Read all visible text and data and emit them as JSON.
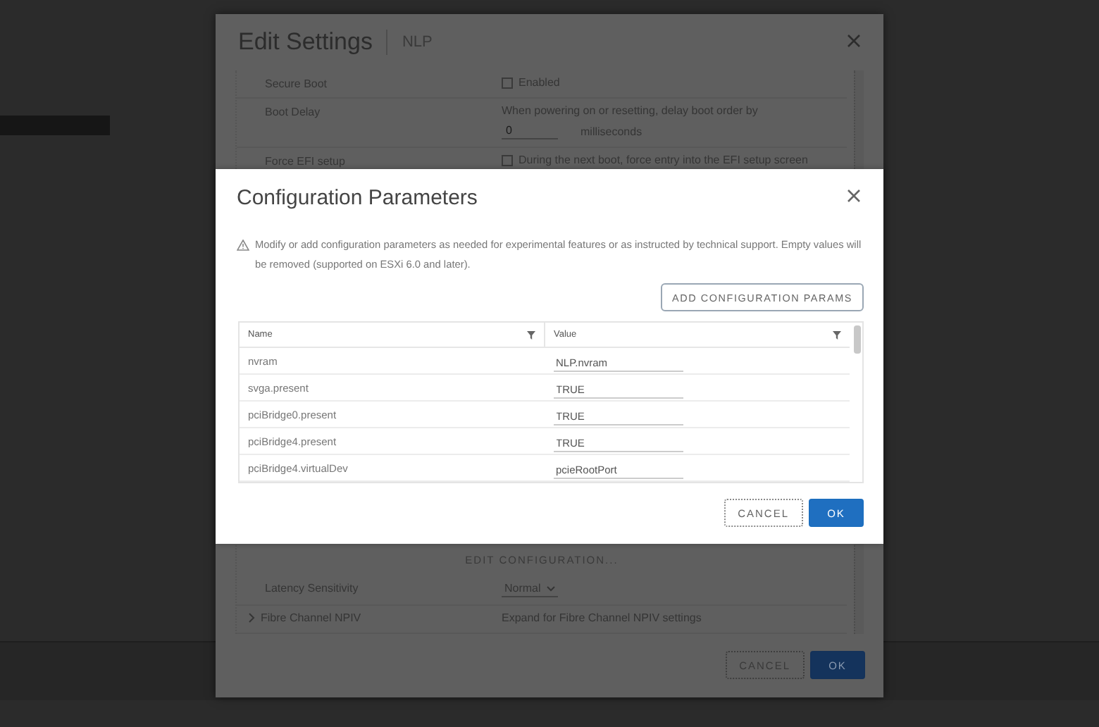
{
  "edit_settings": {
    "title": "Edit Settings",
    "subtitle": "NLP",
    "upper_rows": [
      {
        "kind": "checkbox",
        "label": "Secure Boot",
        "text": "Enabled",
        "checked": false
      },
      {
        "kind": "delay",
        "label": "Boot Delay",
        "text": "When powering on or resetting, delay boot order by",
        "value": "0",
        "unit": "milliseconds"
      },
      {
        "kind": "checkbox",
        "label": "Force EFI setup",
        "text": "During the next boot, force entry into the EFI setup screen",
        "checked": false
      }
    ],
    "edit_config_button": "EDIT CONFIGURATION...",
    "lower_rows": [
      {
        "kind": "select",
        "label": "Latency Sensitivity",
        "value": "Normal"
      },
      {
        "kind": "expander",
        "label": "Fibre Channel NPIV",
        "text": "Expand for Fibre Channel NPIV settings",
        "expanded": false
      }
    ],
    "buttons": [
      {
        "label": "CANCEL",
        "kind": "secondary"
      },
      {
        "label": "OK",
        "kind": "primary"
      }
    ]
  },
  "config_dialog": {
    "title": "Configuration Parameters",
    "warning": "Modify or add configuration parameters as needed for experimental features or as instructed by technical support. Empty values will be removed (supported on ESXi 6.0 and later).",
    "add_button": "ADD CONFIGURATION PARAMS",
    "columns": [
      "Name",
      "Value"
    ],
    "rows": [
      {
        "name": "nvram",
        "value": "NLP.nvram"
      },
      {
        "name": "svga.present",
        "value": "TRUE"
      },
      {
        "name": "pciBridge0.present",
        "value": "TRUE"
      },
      {
        "name": "pciBridge4.present",
        "value": "TRUE"
      },
      {
        "name": "pciBridge4.virtualDev",
        "value": "pcieRootPort"
      }
    ],
    "buttons": [
      {
        "label": "CANCEL",
        "kind": "secondary"
      },
      {
        "label": "OK",
        "kind": "primary"
      }
    ]
  }
}
